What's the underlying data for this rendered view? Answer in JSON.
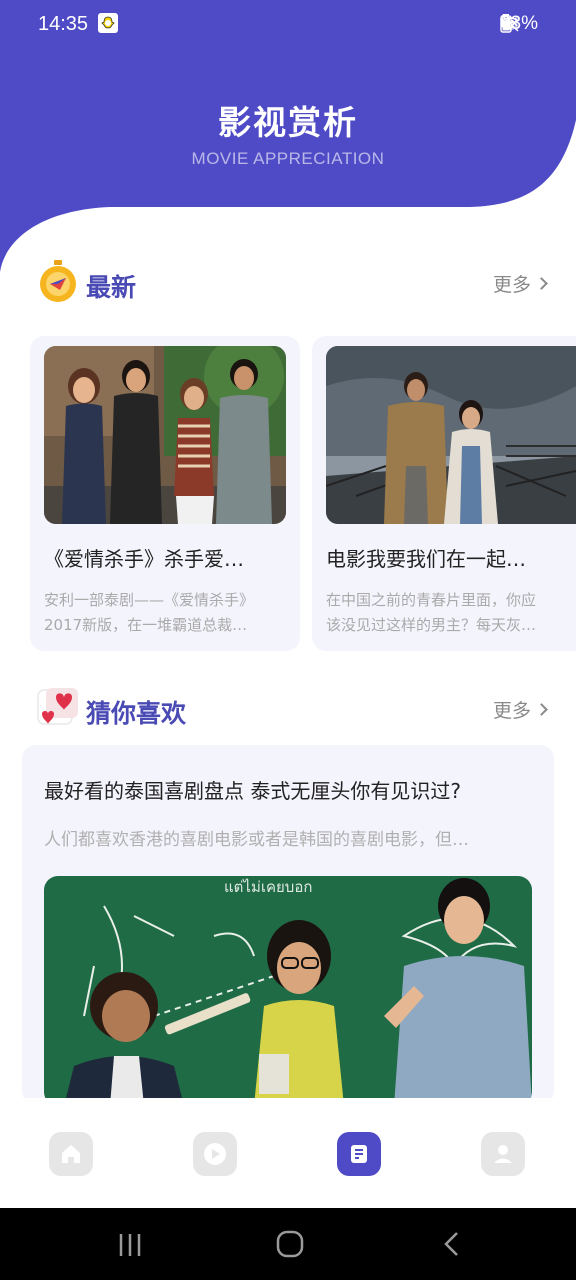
{
  "status_bar": {
    "time": "14:35",
    "battery": "63%",
    "icons_left": [
      "image-icon",
      "cloud-icon",
      "snapchat-icon",
      "dot-icon"
    ],
    "icons_right": [
      "mute-icon",
      "wifi-icon",
      "signal-icon",
      "battery-icon"
    ]
  },
  "header": {
    "title": "影视赏析",
    "subtitle": "MOVIE APPRECIATION",
    "bg_color": "#4f4bc6"
  },
  "latest": {
    "title": "最新",
    "more_label": "更多",
    "cards": [
      {
        "title": "《爱情杀手》杀手爱…",
        "desc_line1": "安利一部泰剧——《爱情杀手》",
        "desc_line2": "2017新版，在一堆霸道总裁…"
      },
      {
        "title": "电影我要我们在一起…",
        "desc_line1": "在中国之前的青春片里面，你应",
        "desc_line2": "该没见过这样的男主？每天灰…"
      }
    ]
  },
  "recommend": {
    "title": "猜你喜欢",
    "more_label": "更多",
    "article": {
      "title": "最好看的泰国喜剧盘点 泰式无厘头你有见识过?",
      "desc": "人们都喜欢香港的喜剧电影或者是韩国的喜剧电影，但…",
      "image_text": "แต่ไม่เคยบอก"
    }
  },
  "tabbar": {
    "tabs": [
      "home-icon",
      "play-icon",
      "article-icon",
      "user-icon"
    ],
    "active_index": 2,
    "active_color": "#4f4bc6"
  }
}
